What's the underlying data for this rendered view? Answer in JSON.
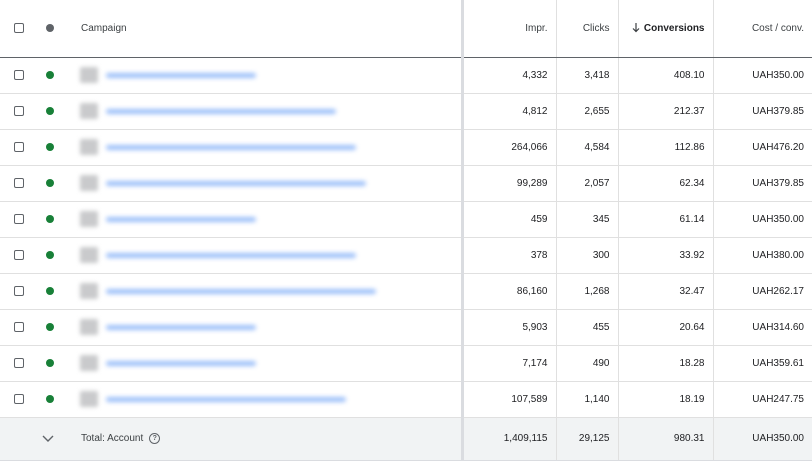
{
  "columns": {
    "campaign": "Campaign",
    "impr": "Impr.",
    "clicks": "Clicks",
    "conversions": "Conversions",
    "cost_conv": "Cost / conv."
  },
  "sort": {
    "column": "conversions",
    "direction": "descending",
    "icon": "arrow-down-icon"
  },
  "rows": [
    {
      "status": "enabled",
      "impr": "4,332",
      "clicks": "3,418",
      "conversions": "408.10",
      "cost_conv": "UAH350.00"
    },
    {
      "status": "enabled",
      "impr": "4,812",
      "clicks": "2,655",
      "conversions": "212.37",
      "cost_conv": "UAH379.85"
    },
    {
      "status": "enabled",
      "impr": "264,066",
      "clicks": "4,584",
      "conversions": "112.86",
      "conversions_link": true,
      "cost_conv": "UAH476.20"
    },
    {
      "status": "enabled",
      "impr": "99,289",
      "clicks": "2,057",
      "conversions": "62.34",
      "cost_conv": "UAH379.85"
    },
    {
      "status": "enabled",
      "impr": "459",
      "clicks": "345",
      "conversions": "61.14",
      "cost_conv": "UAH350.00"
    },
    {
      "status": "enabled",
      "impr": "378",
      "clicks": "300",
      "conversions": "33.92",
      "cost_conv": "UAH380.00"
    },
    {
      "status": "enabled",
      "impr": "86,160",
      "clicks": "1,268",
      "conversions": "32.47",
      "cost_conv": "UAH262.17"
    },
    {
      "status": "enabled",
      "impr": "5,903",
      "clicks": "455",
      "conversions": "20.64",
      "cost_conv": "UAH314.60"
    },
    {
      "status": "enabled",
      "impr": "7,174",
      "clicks": "490",
      "conversions": "18.28",
      "cost_conv": "UAH359.61"
    },
    {
      "status": "enabled",
      "impr": "107,589",
      "clicks": "1,140",
      "conversions": "18.19",
      "cost_conv": "UAH247.75"
    }
  ],
  "total": {
    "label": "Total: Account",
    "impr": "1,409,115",
    "clicks": "29,125",
    "conversions": "980.31",
    "cost_conv": "UAH350.00"
  },
  "colors": {
    "enabled_dot": "#188038",
    "header_dot": "#5f6368",
    "link": "#1a73e8"
  }
}
